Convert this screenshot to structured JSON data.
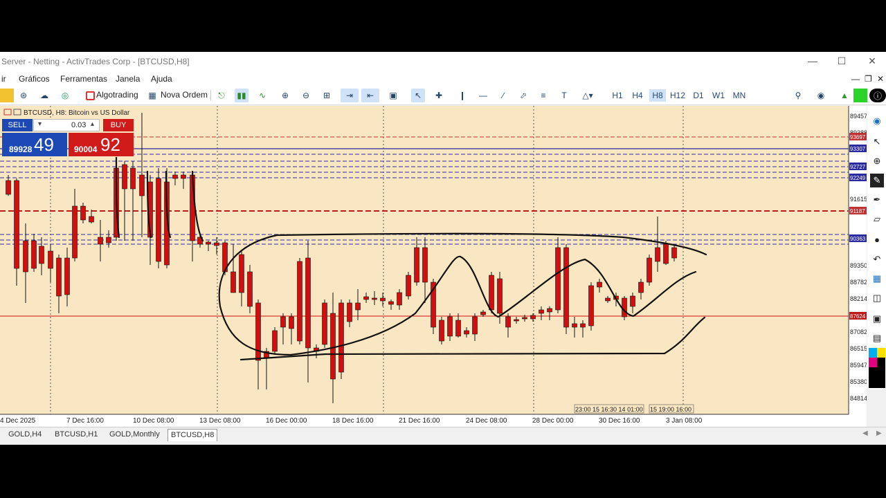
{
  "window": {
    "title": "Server - Netting - ActivTrades Corp - [BTCUSD,H8]"
  },
  "menu": {
    "items": [
      "ir",
      "Gráficos",
      "Ferramentas",
      "Janela",
      "Ajuda"
    ]
  },
  "toolbar": {
    "algotrading": "Algotrading",
    "nova_ordem": "Nova Ordem",
    "timeframes": [
      "H1",
      "H4",
      "H8",
      "H12",
      "D1",
      "W1",
      "MN"
    ],
    "active_timeframe": "H8",
    "text_tool": "T"
  },
  "chart": {
    "header": "BTCUSD, H8:  Bitcoin vs US Dollar",
    "background": "#f9e6c2",
    "bull_color": "#3ccf1e",
    "bear_color": "#d01010",
    "sell_label": "SELL",
    "buy_label": "BUY",
    "volume": "0.03",
    "sell_price_small": "89928",
    "sell_price_big": "49",
    "buy_price_small": "90004",
    "buy_price_big": "92",
    "time_labels": [
      "4 Dec 2025",
      "7 Dec 16:00",
      "10 Dec 08:00",
      "13 Dec 08:00",
      "16 Dec 00:00",
      "18 Dec 16:00",
      "21 Dec 16:00",
      "24 Dec 08:00",
      "28 Dec 00:00",
      "30 Dec 16:00",
      "3 Jan 08:00"
    ],
    "time_marker_a": "23:00 15 16:30 14 01:00",
    "time_marker_b": "15 19:00 16:00",
    "price_labels": [
      "89457",
      "89388",
      "91615",
      "89350",
      "88782",
      "88214",
      "87082",
      "86515",
      "85947",
      "85380",
      "84814.71"
    ],
    "price_badges": [
      "93697",
      "93307",
      "92727",
      "92249",
      "91187",
      "90363",
      "87624"
    ]
  },
  "tabs": [
    "GOLD,H4",
    "BTCUSD,H1",
    "GOLD,Monthly",
    "BTCUSD,H8"
  ],
  "active_tab": "BTCUSD,H8"
}
